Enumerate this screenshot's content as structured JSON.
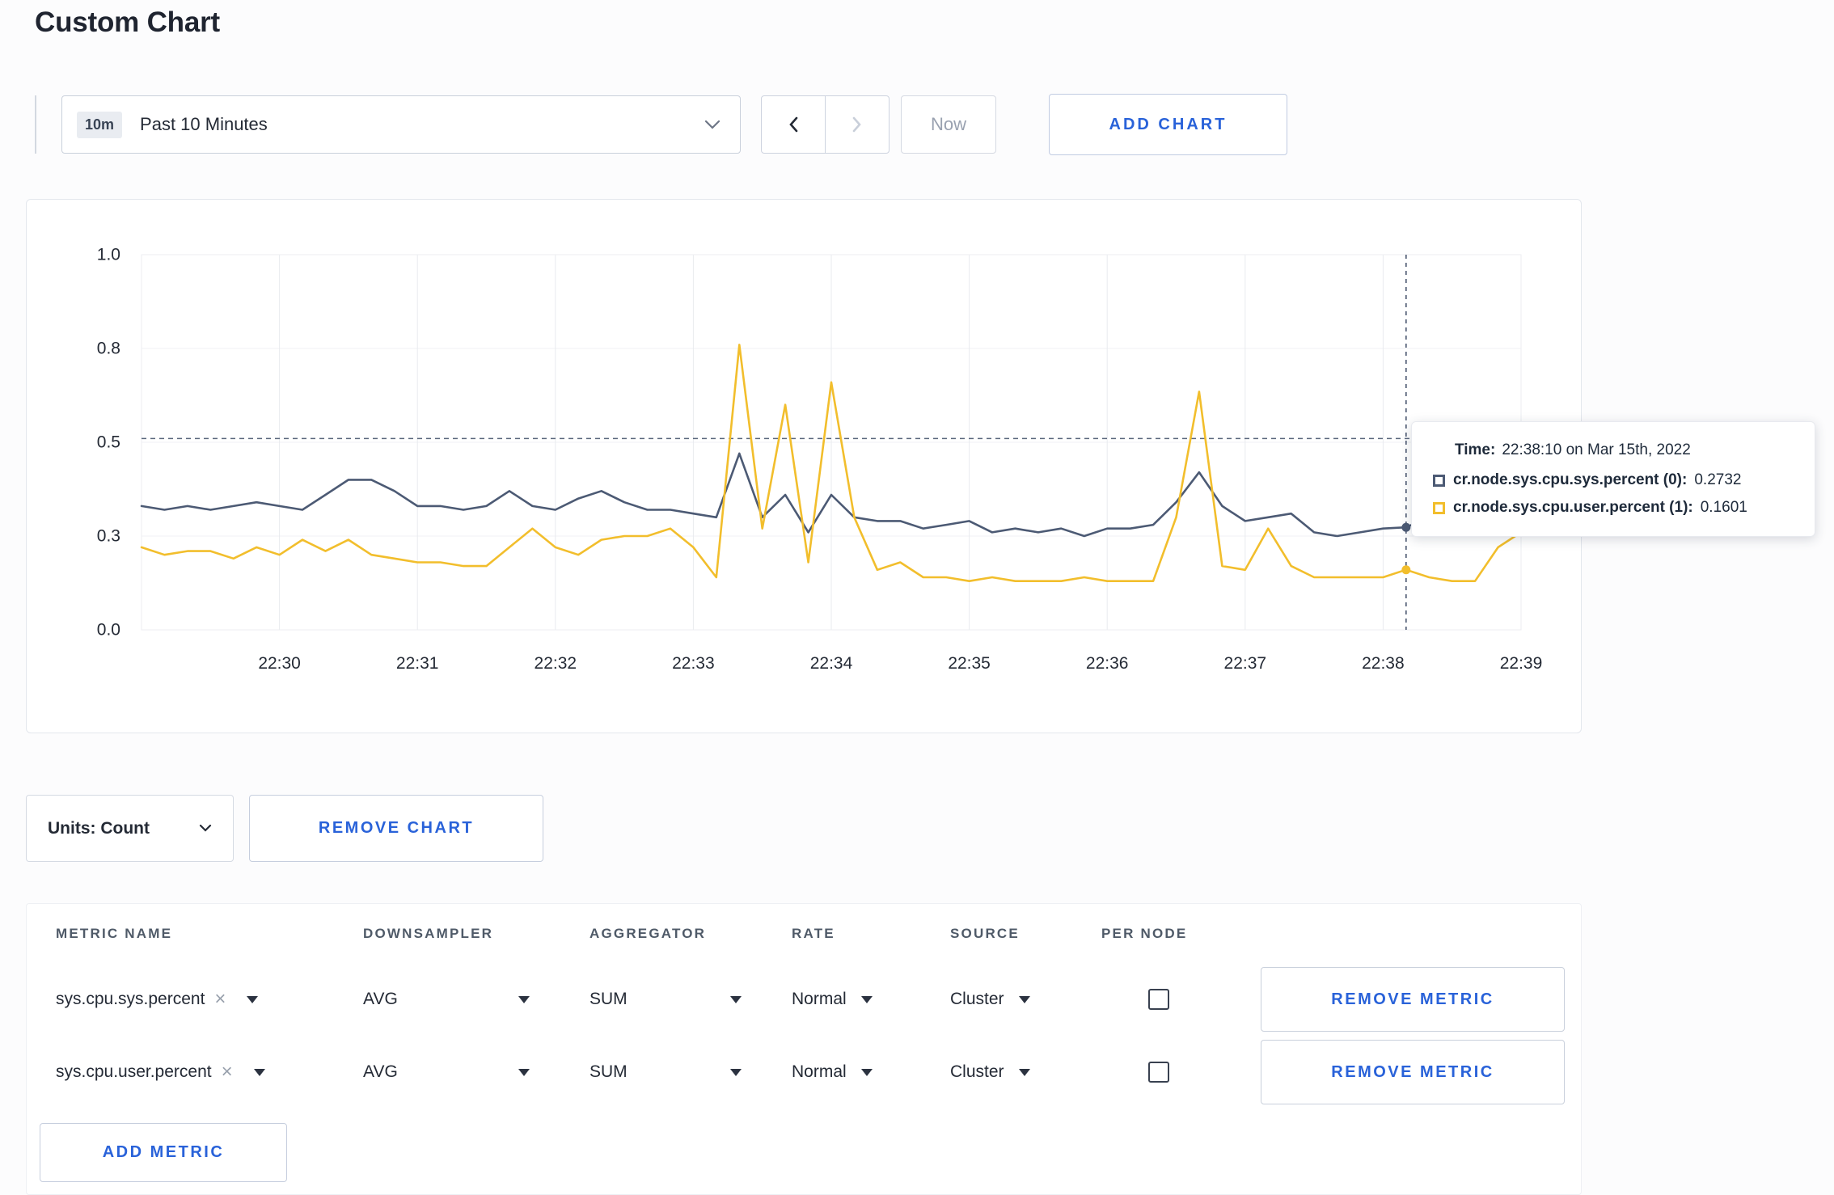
{
  "page": {
    "title": "Custom Chart"
  },
  "colors": {
    "accent_blue": "#2962d9",
    "series_sys": "#4c5a74",
    "series_user": "#f2be2c",
    "text_dark": "#242a35",
    "grid": "#e9ebef",
    "crosshair": "#3e4c66"
  },
  "icons": {
    "clear": "×"
  },
  "toolbar": {
    "time_selector": {
      "badge": "10m",
      "label": "Past 10 Minutes"
    },
    "now_button": "Now",
    "add_chart_button": "ADD CHART"
  },
  "chart_data": {
    "type": "line",
    "title": "",
    "xlabel": "",
    "ylabel": "",
    "ylim": [
      0,
      1
    ],
    "grid": true,
    "legend_position": "tooltip",
    "y_ticks": {
      "values": [
        0,
        0.25,
        0.5,
        0.75,
        1.0
      ],
      "labels": [
        "0.0",
        "0.3",
        "0.5",
        "0.8",
        "1.0"
      ]
    },
    "x_tick_labels": [
      "22:30",
      "22:31",
      "22:32",
      "22:33",
      "22:34",
      "22:35",
      "22:36",
      "22:37",
      "22:38",
      "22:39"
    ],
    "times": [
      "22:29:00",
      "22:29:10",
      "22:29:20",
      "22:29:30",
      "22:29:40",
      "22:29:50",
      "22:30:00",
      "22:30:10",
      "22:30:20",
      "22:30:30",
      "22:30:40",
      "22:30:50",
      "22:31:00",
      "22:31:10",
      "22:31:20",
      "22:31:30",
      "22:31:40",
      "22:31:50",
      "22:32:00",
      "22:32:10",
      "22:32:20",
      "22:32:30",
      "22:32:40",
      "22:32:50",
      "22:33:00",
      "22:33:10",
      "22:33:20",
      "22:33:30",
      "22:33:40",
      "22:33:50",
      "22:34:00",
      "22:34:10",
      "22:34:20",
      "22:34:30",
      "22:34:40",
      "22:34:50",
      "22:35:00",
      "22:35:10",
      "22:35:20",
      "22:35:30",
      "22:35:40",
      "22:35:50",
      "22:36:00",
      "22:36:10",
      "22:36:20",
      "22:36:30",
      "22:36:40",
      "22:36:50",
      "22:37:00",
      "22:37:10",
      "22:37:20",
      "22:37:30",
      "22:37:40",
      "22:37:50",
      "22:38:00",
      "22:38:10",
      "22:38:20",
      "22:38:30",
      "22:38:40",
      "22:38:50",
      "22:39:00"
    ],
    "series": [
      {
        "name": "cr.node.sys.cpu.sys.percent",
        "color": "#4c5a74",
        "values": [
          0.33,
          0.32,
          0.33,
          0.32,
          0.33,
          0.34,
          0.33,
          0.32,
          0.36,
          0.4,
          0.4,
          0.37,
          0.33,
          0.33,
          0.32,
          0.33,
          0.37,
          0.33,
          0.32,
          0.35,
          0.37,
          0.34,
          0.32,
          0.32,
          0.31,
          0.3,
          0.47,
          0.3,
          0.36,
          0.26,
          0.36,
          0.3,
          0.29,
          0.29,
          0.27,
          0.28,
          0.29,
          0.26,
          0.27,
          0.26,
          0.27,
          0.25,
          0.27,
          0.27,
          0.28,
          0.34,
          0.42,
          0.33,
          0.29,
          0.3,
          0.31,
          0.26,
          0.25,
          0.26,
          0.27,
          0.2732,
          0.3,
          0.28,
          0.29,
          0.3,
          0.28
        ]
      },
      {
        "name": "cr.node.sys.cpu.user.percent",
        "color": "#f2be2c",
        "values": [
          0.22,
          0.2,
          0.21,
          0.21,
          0.19,
          0.22,
          0.2,
          0.24,
          0.21,
          0.24,
          0.2,
          0.19,
          0.18,
          0.18,
          0.17,
          0.17,
          0.22,
          0.27,
          0.22,
          0.2,
          0.24,
          0.25,
          0.25,
          0.27,
          0.22,
          0.14,
          0.76,
          0.27,
          0.6,
          0.18,
          0.66,
          0.3,
          0.16,
          0.18,
          0.14,
          0.14,
          0.13,
          0.14,
          0.13,
          0.13,
          0.13,
          0.14,
          0.13,
          0.13,
          0.13,
          0.3,
          0.635,
          0.17,
          0.16,
          0.27,
          0.17,
          0.14,
          0.14,
          0.14,
          0.14,
          0.1601,
          0.14,
          0.13,
          0.13,
          0.22,
          0.26
        ]
      }
    ],
    "threshold_line_y": 0.51,
    "crosshair_time": "22:38:10"
  },
  "tooltip": {
    "time_label": "Time:",
    "time_value": "22:38:10 on Mar 15th, 2022",
    "entries": [
      {
        "name": "cr.node.sys.cpu.sys.percent (0):",
        "value": "0.2732",
        "color": "#4c5a74"
      },
      {
        "name": "cr.node.sys.cpu.user.percent (1):",
        "value": "0.1601",
        "color": "#f2be2c"
      }
    ]
  },
  "units_row": {
    "units_button": "Units: Count",
    "remove_chart_button": "REMOVE CHART"
  },
  "metrics": {
    "headers": [
      "METRIC NAME",
      "DOWNSAMPLER",
      "AGGREGATOR",
      "RATE",
      "SOURCE",
      "PER NODE"
    ],
    "rows": [
      {
        "metric": "sys.cpu.sys.percent",
        "downsampler": "AVG",
        "aggregator": "SUM",
        "rate": "Normal",
        "source": "Cluster",
        "per_node_checked": false,
        "remove_button": "REMOVE METRIC"
      },
      {
        "metric": "sys.cpu.user.percent",
        "downsampler": "AVG",
        "aggregator": "SUM",
        "rate": "Normal",
        "source": "Cluster",
        "per_node_checked": false,
        "remove_button": "REMOVE METRIC"
      }
    ],
    "add_metric_button": "ADD METRIC"
  }
}
